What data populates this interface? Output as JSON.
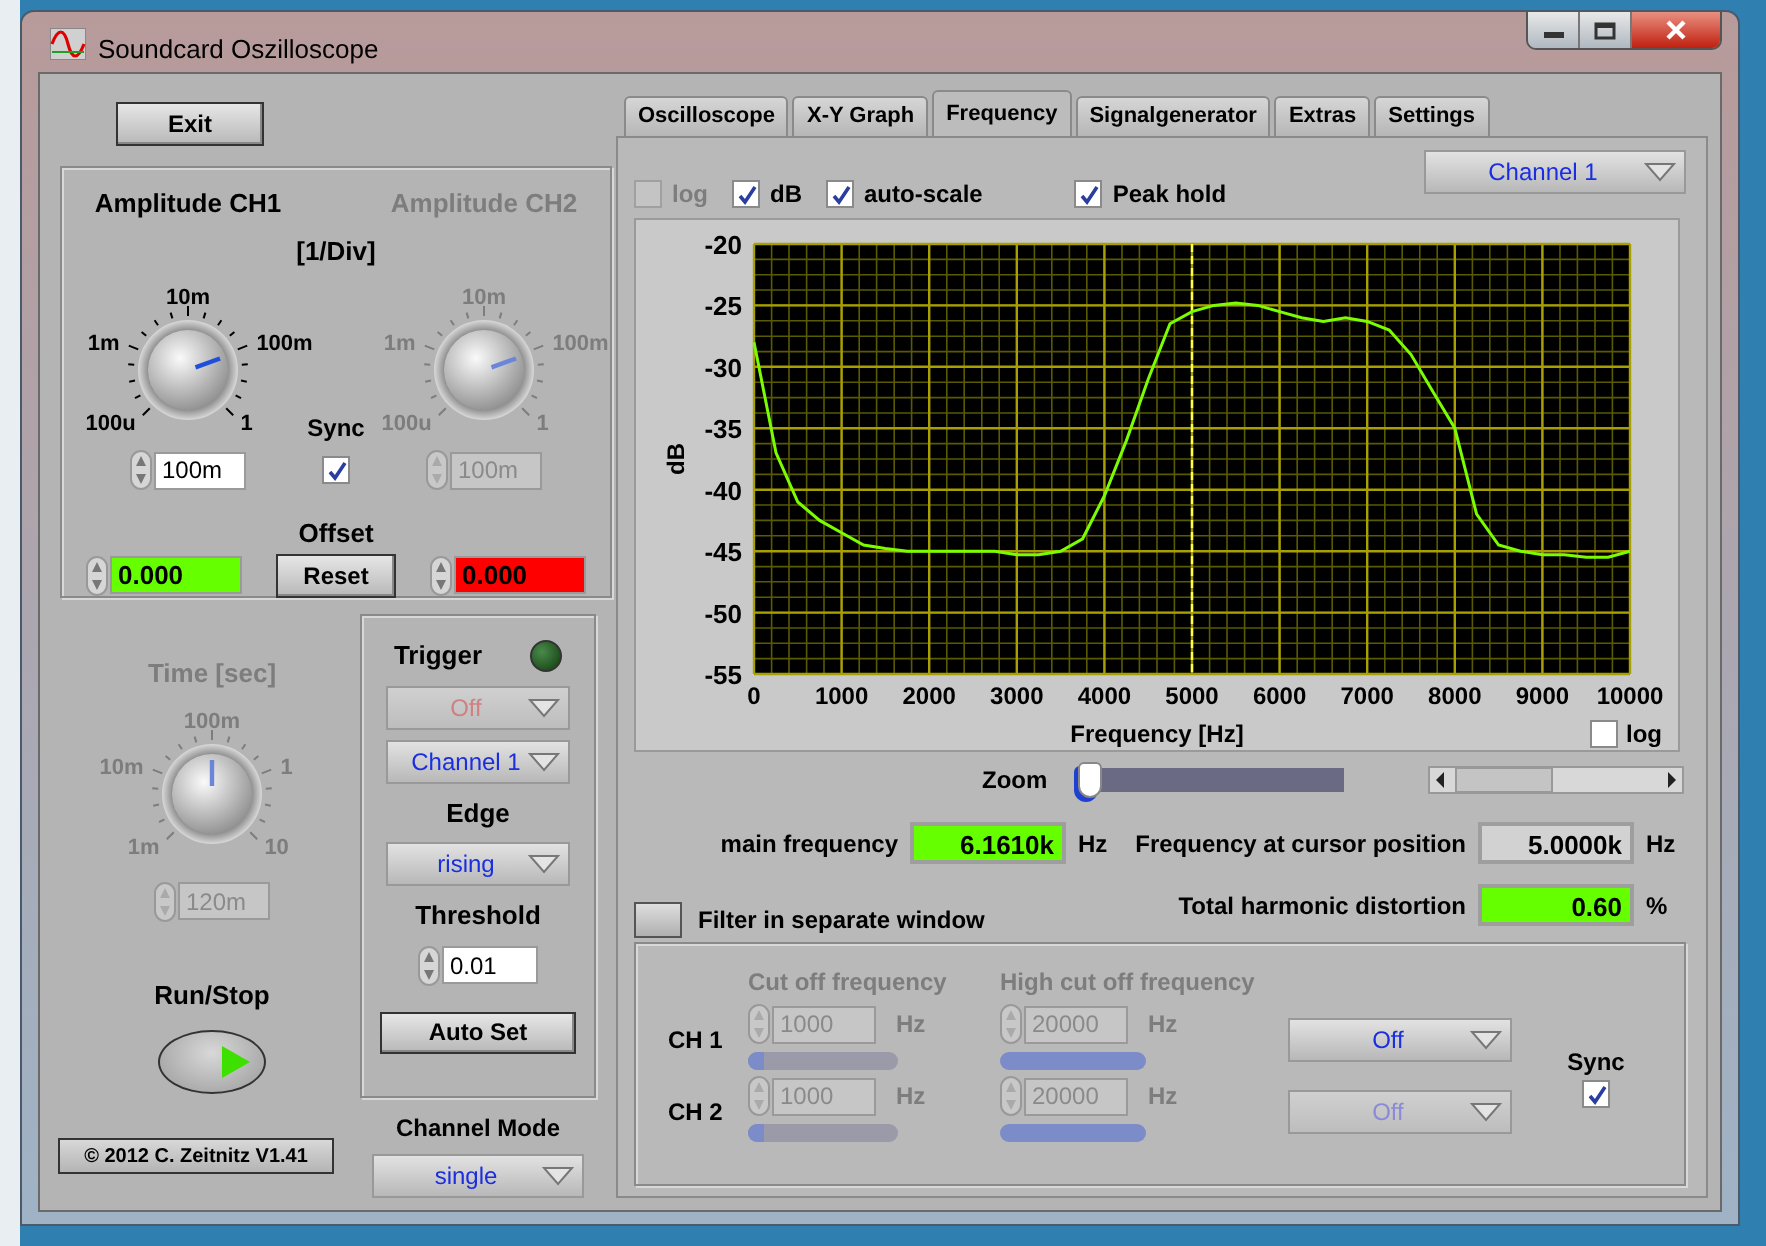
{
  "window": {
    "title": "Soundcard Oszilloscope"
  },
  "exit_button": "Exit",
  "amplitude": {
    "unit": "[1/Div]",
    "knobs": [
      {
        "title": "Amplitude CH1",
        "labels": [
          "100u",
          "1m",
          "10m",
          "100m",
          "1"
        ],
        "value": "100m",
        "disabled": false,
        "level": 0.76
      },
      {
        "title": "Amplitude CH2",
        "labels": [
          "100u",
          "1m",
          "10m",
          "100m",
          "1"
        ],
        "value": "100m",
        "disabled": true,
        "level": 0.76
      }
    ],
    "sync": {
      "label": "Sync",
      "checked": true
    },
    "offset_label": "Offset",
    "reset_button": "Reset",
    "offsets": [
      {
        "value": "0.000",
        "color": "#66ff00"
      },
      {
        "value": "0.000",
        "color": "#ff0000"
      }
    ]
  },
  "time": {
    "title": "Time [sec]",
    "labels": [
      "1m",
      "10m",
      "100m",
      "1",
      "10"
    ],
    "value": "120m",
    "disabled": true,
    "level": 0.5
  },
  "run_stop": {
    "label": "Run/Stop"
  },
  "copyright": "© 2012  C. Zeitnitz V1.41",
  "trigger": {
    "title": "Trigger",
    "led_on": false,
    "dropdowns": [
      {
        "value": "Off",
        "disabled": true
      },
      {
        "value": "Channel 1",
        "disabled": false
      }
    ],
    "edge_label": "Edge",
    "edge": {
      "value": "rising",
      "disabled": false
    },
    "threshold_label": "Threshold",
    "threshold": "0.01",
    "auto_set_button": "Auto Set"
  },
  "channel_mode": {
    "label": "Channel Mode",
    "value": "single",
    "disabled": false
  },
  "tabs": [
    {
      "label": "Oscilloscope",
      "selected": false
    },
    {
      "label": "X-Y Graph",
      "selected": false
    },
    {
      "label": "Frequency",
      "selected": true
    },
    {
      "label": "Signalgenerator",
      "selected": false
    },
    {
      "label": "Extras",
      "selected": false
    },
    {
      "label": "Settings",
      "selected": false
    }
  ],
  "frequency": {
    "channel_select": {
      "value": "Channel 1",
      "disabled": false
    },
    "options": [
      {
        "label": "log",
        "checked": false,
        "disabled": true
      },
      {
        "label": "dB",
        "checked": true,
        "disabled": false
      },
      {
        "label": "auto-scale",
        "checked": true,
        "disabled": false
      },
      {
        "label": "Peak hold",
        "checked": true,
        "disabled": false
      }
    ],
    "chart_data": {
      "type": "line",
      "xlabel": "Frequency [Hz]",
      "ylabel": "dB",
      "xlim": [
        0,
        10000
      ],
      "ylim": [
        -55,
        -20
      ],
      "xticks": [
        0,
        1000,
        2000,
        3000,
        4000,
        5000,
        6000,
        7000,
        8000,
        9000,
        10000
      ],
      "yticks": [
        -55,
        -50,
        -45,
        -40,
        -35,
        -30,
        -25,
        -20
      ],
      "x": [
        0,
        250,
        500,
        750,
        1000,
        1250,
        1500,
        1750,
        2000,
        2250,
        2500,
        2750,
        3000,
        3250,
        3500,
        3750,
        4000,
        4250,
        4500,
        4750,
        5000,
        5250,
        5500,
        5750,
        6000,
        6250,
        6500,
        6750,
        7000,
        7250,
        7500,
        7750,
        8000,
        8250,
        8500,
        8750,
        9000,
        9250,
        9500,
        9750,
        10000
      ],
      "series": [
        {
          "color": "#7cfc00",
          "values": [
            -28,
            -37,
            -41,
            -42.5,
            -43.5,
            -44.5,
            -44.8,
            -45,
            -45,
            -45,
            -45,
            -45,
            -45.3,
            -45.3,
            -45,
            -44,
            -40.5,
            -36,
            -31,
            -26.5,
            -25.5,
            -25,
            -24.8,
            -25,
            -25.5,
            -26,
            -26.3,
            -26,
            -26.3,
            -27,
            -29,
            -32,
            -35,
            -42,
            -44.5,
            -45,
            -45.3,
            -45.3,
            -45.5,
            -45.5,
            -45
          ]
        }
      ],
      "grid": true,
      "ref_lines": [
        {
          "axis": "x",
          "value": 5000,
          "color": "#ffff40"
        }
      ]
    },
    "x_log": {
      "label": "log",
      "checked": false
    },
    "zoom": {
      "label": "Zoom",
      "level": 0
    },
    "readouts": [
      {
        "label": "main frequency",
        "value": "6.1610k",
        "unit": "Hz",
        "highlight": true
      },
      {
        "label": "Frequency at cursor position",
        "value": "5.0000k",
        "unit": "Hz",
        "highlight": false
      },
      {
        "label": "Total harmonic distortion",
        "value": "0.60",
        "unit": "%",
        "highlight": true
      }
    ],
    "filter_window": {
      "label": "Filter in separate window",
      "on": false
    },
    "filter": {
      "column_titles": [
        "Cut off frequency",
        "High cut off frequency"
      ],
      "disabled": true,
      "rows": [
        {
          "label": "CH 1",
          "low": "1000",
          "low_unit": "Hz",
          "low_slider": {
            "level": 0.1
          },
          "high": "20000",
          "high_unit": "Hz",
          "high_slider": {
            "level": 1
          },
          "mode": {
            "value": "Off",
            "disabled": false
          }
        },
        {
          "label": "CH 2",
          "low": "1000",
          "low_unit": "Hz",
          "low_slider": {
            "level": 0.1
          },
          "high": "20000",
          "high_unit": "Hz",
          "high_slider": {
            "level": 1
          },
          "mode": {
            "value": "Off",
            "disabled": true
          }
        }
      ],
      "sync": {
        "label": "Sync",
        "checked": true
      }
    }
  }
}
